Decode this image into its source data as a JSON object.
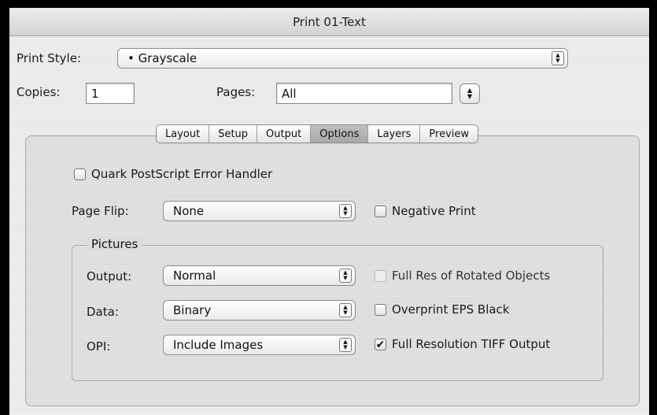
{
  "window": {
    "title": "Print 01-Text"
  },
  "print_style": {
    "label": "Print Style:",
    "value": "• Grayscale"
  },
  "copies": {
    "label": "Copies:",
    "value": "1"
  },
  "pages": {
    "label": "Pages:",
    "value": "All"
  },
  "tabs": [
    {
      "label": "Layout"
    },
    {
      "label": "Setup"
    },
    {
      "label": "Output"
    },
    {
      "label": "Options",
      "active": true
    },
    {
      "label": "Layers"
    },
    {
      "label": "Preview"
    }
  ],
  "options": {
    "error_handler": {
      "label": "Quark PostScript Error Handler",
      "checked": false
    },
    "page_flip": {
      "label": "Page Flip:",
      "value": "None"
    },
    "negative_print": {
      "label": "Negative Print",
      "checked": false
    },
    "pictures": {
      "title": "Pictures",
      "output": {
        "label": "Output:",
        "value": "Normal"
      },
      "data": {
        "label": "Data:",
        "value": "Binary"
      },
      "opi": {
        "label": "OPI:",
        "value": "Include Images"
      },
      "full_res_rotated": {
        "label": "Full Res of Rotated Objects",
        "checked": false,
        "enabled": false
      },
      "overprint_eps": {
        "label": "Overprint EPS Black",
        "checked": false
      },
      "full_res_tiff": {
        "label": "Full Resolution TIFF Output",
        "checked": true
      }
    }
  }
}
